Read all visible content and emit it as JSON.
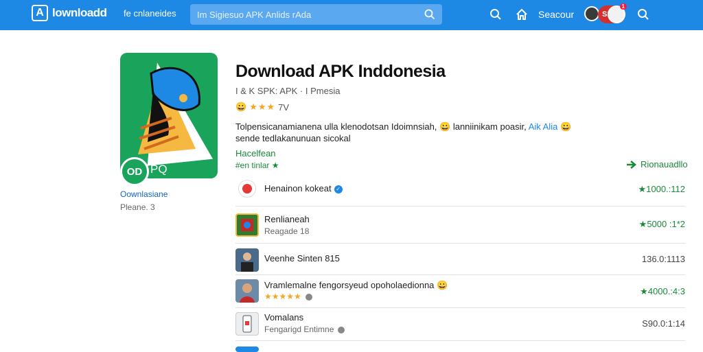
{
  "header": {
    "logo_mark": "A",
    "logo_text": "lownloadd",
    "category_label": "fe cnlaneides",
    "search_placeholder": "Im Sigiesuo APK Anlids rAda",
    "search_label": "Seacour",
    "avatar_badge_text": "SS",
    "notification_count": "1"
  },
  "app": {
    "title": "Download APK Inddonesia",
    "subtitle": "I & K SPK: APK · I Pmesia",
    "rating_stars": "★★★",
    "rating_text": "7V",
    "badge_text": "OD",
    "badge_label": "PQ",
    "developer": "Oownlasiane",
    "developer_sub": "Pleane. 3",
    "description_line1": "Tolpensicanamianena ulla klenodotsan Idoimnsiah, 😀 lanniinikam poasir,",
    "description_link": "Aik Alia",
    "description_line2": "sende tedlakanunuan sicokal",
    "section_label": "Hacelfean",
    "section_sub": "#en tinlar ★",
    "related_label": "Rionauadllo"
  },
  "list": [
    {
      "name": "Henainon kokeat",
      "meta": "",
      "value": "★1000.:112",
      "value_color": "green",
      "verified": true
    },
    {
      "name": "Renlianeah",
      "meta": "Reagade  18",
      "value": "★5000 :1*2",
      "value_color": "green",
      "verified": false
    },
    {
      "name": "Veenhe Sinten  815",
      "meta": "",
      "value": "136.0:1113",
      "value_color": "gray",
      "verified": false
    },
    {
      "name": "Vramlemalne fengorsyeud opoholaedionna 😀",
      "meta": "★★★★★",
      "value": "★4000.:4:3",
      "value_color": "green",
      "verified": false
    },
    {
      "name": "Vomalans",
      "meta": "Fengarigd Entimne",
      "value": "S90.0:1:14",
      "value_color": "gray",
      "verified": false
    }
  ],
  "colors": {
    "topbar": "#1e88e5",
    "app_green": "#1aa35a",
    "accent_green": "#1a8a3a",
    "link_blue": "#1e88e5"
  }
}
